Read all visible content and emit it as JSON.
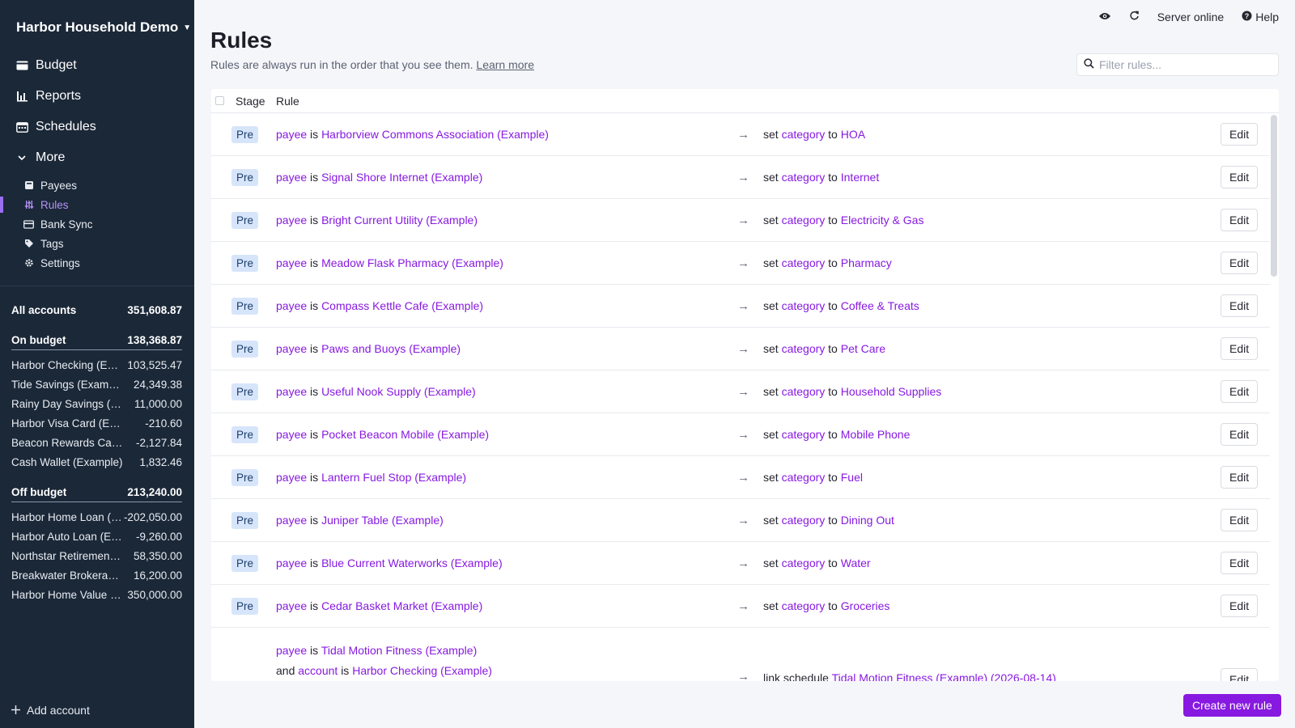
{
  "sidebar": {
    "budget_name": "Harbor Household Demo",
    "nav": [
      {
        "label": "Budget",
        "icon": "wallet-icon"
      },
      {
        "label": "Reports",
        "icon": "bar-chart-icon"
      },
      {
        "label": "Schedules",
        "icon": "calendar-icon"
      },
      {
        "label": "More",
        "icon": "chevron-down-icon"
      }
    ],
    "sub_nav": [
      {
        "label": "Payees",
        "icon": "bookmark-icon",
        "active": false
      },
      {
        "label": "Rules",
        "icon": "sliders-icon",
        "active": true
      },
      {
        "label": "Bank Sync",
        "icon": "credit-card-icon",
        "active": false
      },
      {
        "label": "Tags",
        "icon": "tag-icon",
        "active": false
      },
      {
        "label": "Settings",
        "icon": "gear-icon",
        "active": false
      }
    ],
    "all_accounts": {
      "label": "All accounts",
      "balance": "351,608.87"
    },
    "on_budget": {
      "label": "On budget",
      "balance": "138,368.87",
      "accounts": [
        {
          "name": "Harbor Checking (Example)",
          "balance": "103,525.47"
        },
        {
          "name": "Tide Savings (Example)",
          "balance": "24,349.38"
        },
        {
          "name": "Rainy Day Savings (Example)",
          "balance": "11,000.00"
        },
        {
          "name": "Harbor Visa Card (Example)",
          "balance": "-210.60"
        },
        {
          "name": "Beacon Rewards Card (Example)",
          "balance": "-2,127.84"
        },
        {
          "name": "Cash Wallet (Example)",
          "balance": "1,832.46"
        }
      ]
    },
    "off_budget": {
      "label": "Off budget",
      "balance": "213,240.00",
      "accounts": [
        {
          "name": "Harbor Home Loan (Example)",
          "balance": "-202,050.00"
        },
        {
          "name": "Harbor Auto Loan (Example)",
          "balance": "-9,260.00"
        },
        {
          "name": "Northstar Retirement (Example)",
          "balance": "58,350.00"
        },
        {
          "name": "Breakwater Brokerage (Example)",
          "balance": "16,200.00"
        },
        {
          "name": "Harbor Home Value (Example)",
          "balance": "350,000.00"
        }
      ]
    },
    "add_account": "Add account"
  },
  "topbar": {
    "server_status": "Server online",
    "help": "Help"
  },
  "header": {
    "title": "Rules",
    "description": "Rules are always run in the order that you see them.",
    "learn_more": "Learn more",
    "filter_placeholder": "Filter rules..."
  },
  "table": {
    "col_stage": "Stage",
    "col_rule": "Rule",
    "edit_label": "Edit",
    "kw_is": "is",
    "kw_set": "set",
    "kw_to": "to",
    "kw_and": "and",
    "field_payee": "payee",
    "field_category": "category",
    "field_account": "account",
    "rows": [
      {
        "stage": "Pre",
        "payee": "Harborview Commons Association (Example)",
        "category": "HOA"
      },
      {
        "stage": "Pre",
        "payee": "Signal Shore Internet (Example)",
        "category": "Internet"
      },
      {
        "stage": "Pre",
        "payee": "Bright Current Utility (Example)",
        "category": "Electricity & Gas"
      },
      {
        "stage": "Pre",
        "payee": "Meadow Flask Pharmacy (Example)",
        "category": "Pharmacy"
      },
      {
        "stage": "Pre",
        "payee": "Compass Kettle Cafe (Example)",
        "category": "Coffee & Treats"
      },
      {
        "stage": "Pre",
        "payee": "Paws and Buoys (Example)",
        "category": "Pet Care"
      },
      {
        "stage": "Pre",
        "payee": "Useful Nook Supply (Example)",
        "category": "Household Supplies"
      },
      {
        "stage": "Pre",
        "payee": "Pocket Beacon Mobile (Example)",
        "category": "Mobile Phone"
      },
      {
        "stage": "Pre",
        "payee": "Lantern Fuel Stop (Example)",
        "category": "Fuel"
      },
      {
        "stage": "Pre",
        "payee": "Juniper Table (Example)",
        "category": "Dining Out"
      },
      {
        "stage": "Pre",
        "payee": "Blue Current Waterworks (Example)",
        "category": "Water"
      },
      {
        "stage": "Pre",
        "payee": "Cedar Basket Market (Example)",
        "category": "Groceries"
      }
    ],
    "schedule_row": {
      "payee": "Tidal Motion Fitness (Example)",
      "account": "Harbor Checking (Example)",
      "action": "link schedule",
      "schedule": "Tidal Motion Fitness (Example) (2026-08-14)"
    }
  },
  "create_rule": "Create new rule"
}
